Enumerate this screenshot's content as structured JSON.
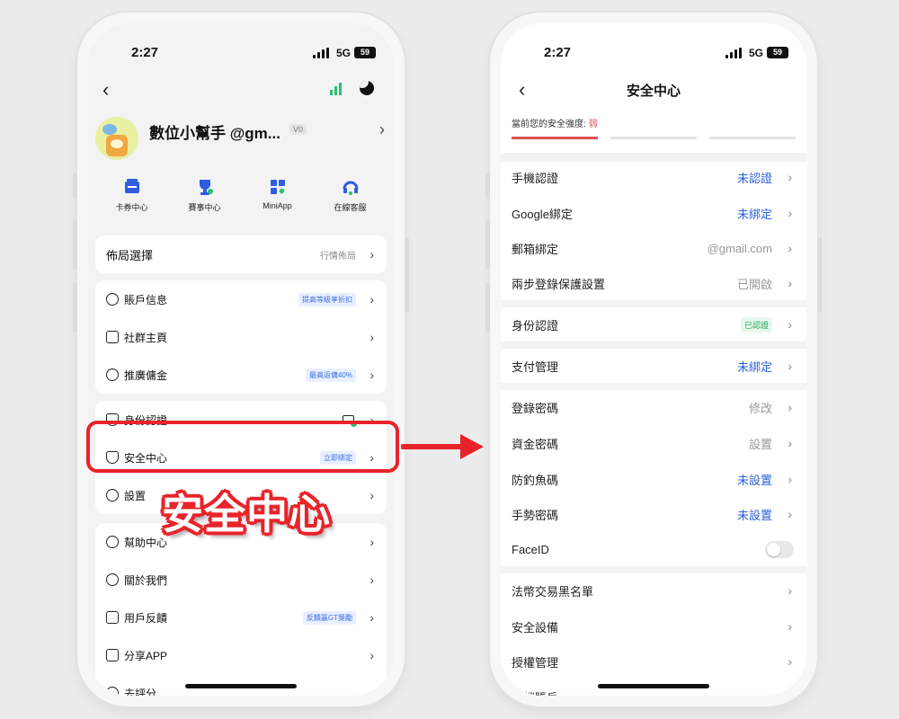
{
  "status": {
    "time": "2:27",
    "network": "5G",
    "battery": "59"
  },
  "left": {
    "username": "數位小幫手 @gm...",
    "vip": "V0",
    "shortcuts": [
      {
        "label": "卡券中心",
        "icon": "ticket-icon"
      },
      {
        "label": "賽事中心",
        "icon": "trophy-icon"
      },
      {
        "label": "MiniApp",
        "icon": "miniapp-icon"
      },
      {
        "label": "在線客服",
        "icon": "headset-icon"
      }
    ],
    "layout": {
      "label": "佈局選擇",
      "value": "行情佈局"
    },
    "account_group": [
      {
        "label": "賬戶信息",
        "tag": "提高等級享折扣",
        "icon": "user-circle-icon"
      },
      {
        "label": "社群主頁",
        "tag": "",
        "icon": "chat-icon"
      },
      {
        "label": "推廣傭金",
        "tag": "最高返傭40%",
        "icon": "coins-icon"
      }
    ],
    "security_group": [
      {
        "label": "身份認證",
        "icon": "id-shield-icon"
      },
      {
        "label": "安全中心",
        "tag": "立即綁定",
        "icon": "shield-check-icon"
      },
      {
        "label": "設置",
        "icon": "settings-icon"
      }
    ],
    "help_group": [
      {
        "label": "幫助中心",
        "tag": "",
        "icon": "help-icon"
      },
      {
        "label": "關於我們",
        "tag": "",
        "icon": "info-icon"
      },
      {
        "label": "用戶反饋",
        "tag": "反饋贏GT獎勵",
        "icon": "feedback-icon"
      },
      {
        "label": "分享APP",
        "tag": "",
        "icon": "share-icon"
      },
      {
        "label": "去評分",
        "tag": "",
        "icon": "star-icon"
      }
    ],
    "overlay_label": "安全中心"
  },
  "right": {
    "title": "安全中心",
    "strength_label": "當前您的安全強度: ",
    "strength_value": "弱",
    "strength_level": 1,
    "strength_levels": 3,
    "group1": [
      {
        "label": "手機認證",
        "value": "未認證",
        "color": "blue"
      },
      {
        "label": "Google綁定",
        "value": "未綁定",
        "color": "blue"
      },
      {
        "label": "郵箱綁定",
        "value": "@gmail.com",
        "color": "gray"
      },
      {
        "label": "兩步登錄保護設置",
        "value": "已開啟",
        "color": "gray"
      }
    ],
    "group2": [
      {
        "label": "身份認證",
        "value": "已認證",
        "color": "green"
      }
    ],
    "group3": [
      {
        "label": "支付管理",
        "value": "未綁定",
        "color": "blue"
      }
    ],
    "group4": [
      {
        "label": "登錄密碼",
        "value": "修改",
        "color": "gray"
      },
      {
        "label": "資金密碼",
        "value": "設置",
        "color": "gray"
      },
      {
        "label": "防釣魚碼",
        "value": "未設置",
        "color": "blue"
      },
      {
        "label": "手勢密碼",
        "value": "未設置",
        "color": "blue"
      },
      {
        "label": "FaceID",
        "value": "",
        "color": "toggle"
      }
    ],
    "group5": [
      {
        "label": "法幣交易黑名單",
        "value": "",
        "color": "gray"
      },
      {
        "label": "安全設備",
        "value": "",
        "color": "gray"
      },
      {
        "label": "授權管理",
        "value": "",
        "color": "gray"
      },
      {
        "label": "註銷賬戶",
        "value": "",
        "color": "gray"
      }
    ]
  },
  "colors": {
    "accent_red": "#e8242a",
    "link_blue": "#2b5fd9",
    "tag_blue": "#3c6fe0",
    "ok_green": "#27a85f"
  }
}
